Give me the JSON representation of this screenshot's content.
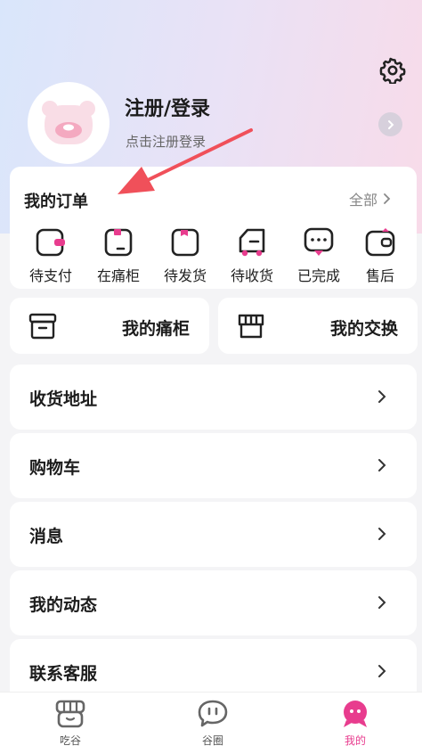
{
  "header": {
    "login_title": "注册/登录",
    "login_subtitle": "点击注册登录"
  },
  "orders": {
    "title": "我的订单",
    "view_all": "全部",
    "items": [
      {
        "label": "待支付",
        "icon": "wallet-pending-icon"
      },
      {
        "label": "在痛柜",
        "icon": "box-icon"
      },
      {
        "label": "待发货",
        "icon": "package-icon"
      },
      {
        "label": "待收货",
        "icon": "truck-icon"
      },
      {
        "label": "已完成",
        "icon": "chat-dots-icon"
      },
      {
        "label": "售后",
        "icon": "wallet-refund-icon"
      }
    ]
  },
  "shortcuts": {
    "cabinet": "我的痛柜",
    "exchange": "我的交换"
  },
  "menu": [
    {
      "label": "收货地址"
    },
    {
      "label": "购物车"
    },
    {
      "label": "消息"
    },
    {
      "label": "我的动态"
    },
    {
      "label": "联系客服"
    }
  ],
  "tabbar": [
    {
      "label": "吃谷",
      "icon": "shop-icon"
    },
    {
      "label": "谷圈",
      "icon": "chat-bubble-icon"
    },
    {
      "label": "我的",
      "icon": "profile-mascot-icon"
    }
  ],
  "colors": {
    "accent": "#e83c8e",
    "annotation_arrow": "#f0505a"
  }
}
